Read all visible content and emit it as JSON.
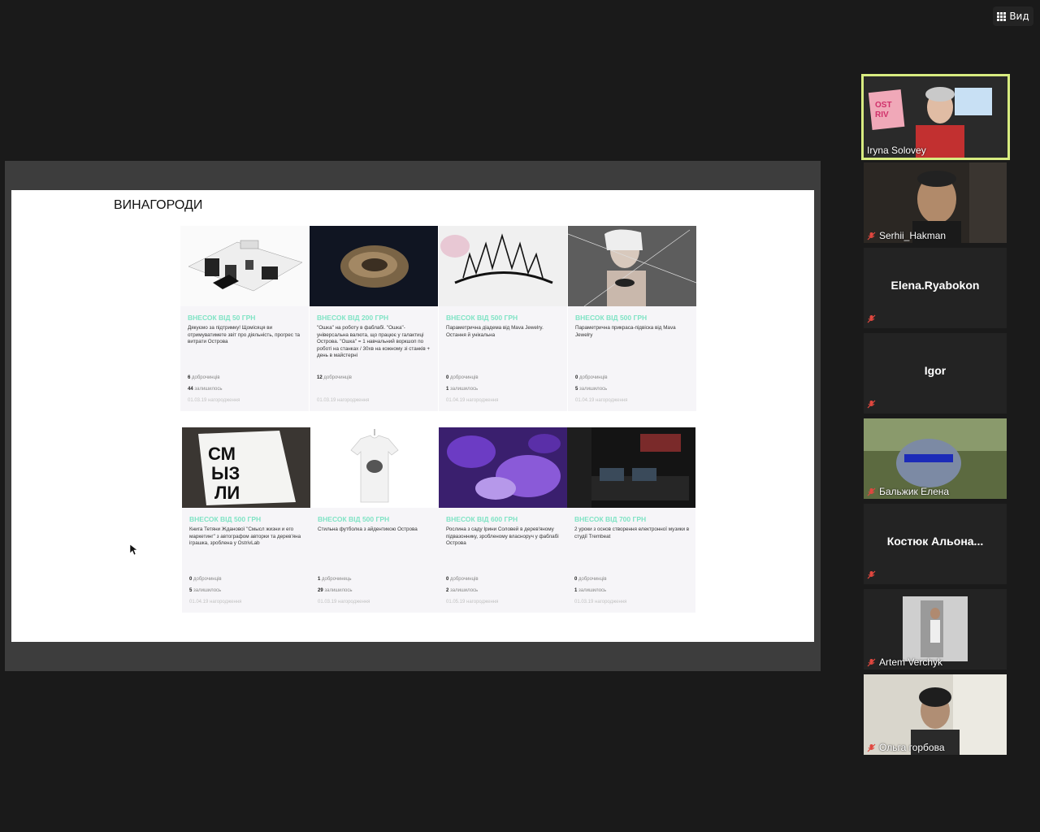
{
  "view_button": {
    "label": "Вид"
  },
  "slide": {
    "title": "ВИНАГОРОДИ",
    "cards": [
      {
        "price": "ВНЕСОК ВІД 50 ГРН",
        "desc": "Дякуємо за підтримку! Щомісяця ви отримуватимете звіт про діяльність, прогрес та витрати Острова",
        "backers_n": "6",
        "backers_t": "доброчинців",
        "left_n": "44",
        "left_t": "залишилось",
        "date": "01.03.19 нагородження"
      },
      {
        "price": "ВНЕСОК ВІД 200 ГРН",
        "desc": "\"Ошка\" на роботу в фаблабі. \"Ошка\"- універсальна валюта, що працює у галактиці Острова. \"Ошка\" = 1 навчальний воркшоп по роботі на станках / 30хв на кожному зі станків + день в майстерні",
        "backers_n": "12",
        "backers_t": "доброчинців",
        "left_n": "",
        "left_t": "",
        "date": "01.03.19 нагородження"
      },
      {
        "price": "ВНЕСОК ВІД 500 ГРН",
        "desc": "Параметрична діадема від Mava Jewelry. Остання й унікальна",
        "backers_n": "0",
        "backers_t": "доброчинців",
        "left_n": "1",
        "left_t": "залишилось",
        "date": "01.04.19 нагородження"
      },
      {
        "price": "ВНЕСОК ВІД 500 ГРН",
        "desc": "Параметрична прикраса-підвіска від Mava Jewelry",
        "backers_n": "0",
        "backers_t": "доброчинців",
        "left_n": "5",
        "left_t": "залишилось",
        "date": "01.04.19 нагородження"
      },
      {
        "price": "ВНЕСОК ВІД 500 ГРН",
        "desc": "Книга Тетяни Жданової \"Смысл жизни и его маркетинг\" з автографом авторки та дерев'яна іграшка, зроблена у OstrivLab",
        "backers_n": "0",
        "backers_t": "доброчинців",
        "left_n": "5",
        "left_t": "залишилось",
        "date": "01.04.19 нагородження"
      },
      {
        "price": "ВНЕСОК ВІД 500 ГРН",
        "desc": "Стильна футболка з айдентикою Острова",
        "backers_n": "1",
        "backers_t": "доброчинець",
        "left_n": "29",
        "left_t": "залишилось",
        "date": "01.03.19 нагородження"
      },
      {
        "price": "ВНЕСОК ВІД 600 ГРН",
        "desc": "Рослина з саду Ірини Соловей в дерев'яному підвазоннику, зробленому власноруч у фаблабі Острова",
        "backers_n": "0",
        "backers_t": "доброчинців",
        "left_n": "2",
        "left_t": "залишилось",
        "date": "01.05.19 нагородження"
      },
      {
        "price": "ВНЕСОК ВІД 700 ГРН",
        "desc": "2 уроки з основ створення електронної музики в студії Trembeat",
        "backers_n": "0",
        "backers_t": "доброчинців",
        "left_n": "1",
        "left_t": "залишилось",
        "date": "01.03.19 нагородження"
      }
    ]
  },
  "participants": [
    {
      "name": "Iryna Solovey",
      "muted": false,
      "video": true
    },
    {
      "name": "Serhii_Hakman",
      "muted": true,
      "video": true
    },
    {
      "name": "Elena.Ryabokon",
      "muted": true,
      "video": false
    },
    {
      "name": "Igor",
      "muted": true,
      "video": false
    },
    {
      "name": "Бальжик Елена",
      "muted": true,
      "video": true
    },
    {
      "name": "Костюк  Альона...",
      "muted": true,
      "video": false
    },
    {
      "name": "Artem Verchyk",
      "muted": true,
      "video": true
    },
    {
      "name": "Ольга горбова",
      "muted": true,
      "video": true
    }
  ],
  "colors": {
    "accent_price": "#7fe3c4",
    "active_speaker_border": "#d8ec80",
    "mute_icon": "#e0473f"
  }
}
